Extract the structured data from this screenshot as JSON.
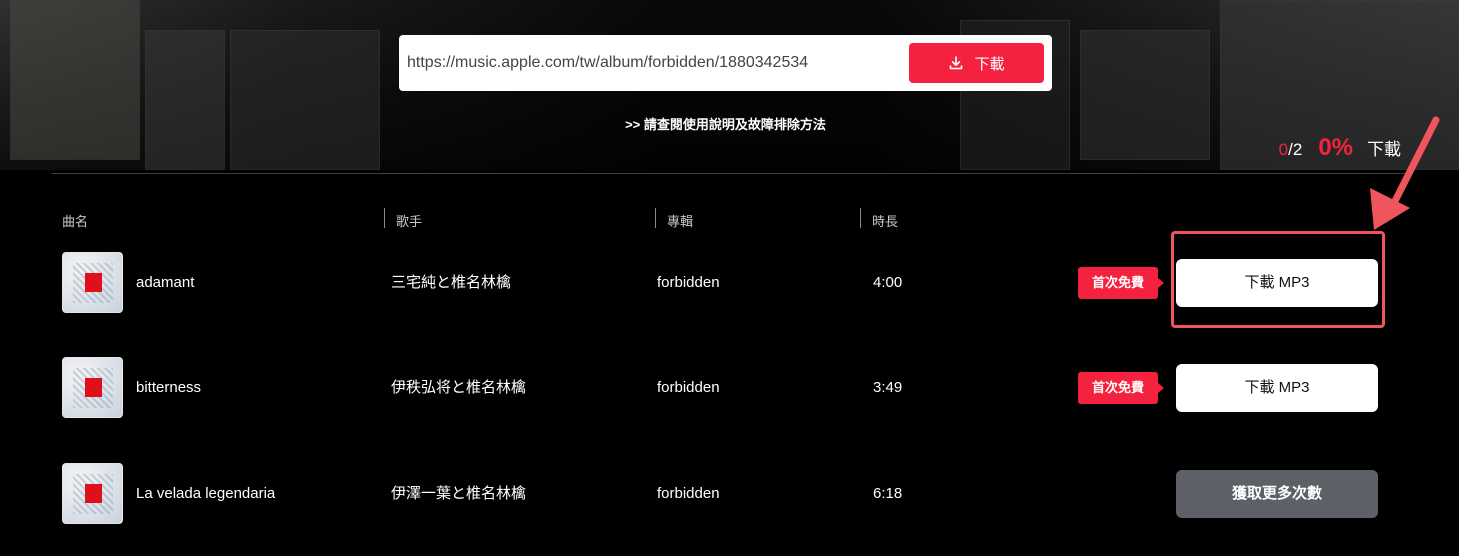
{
  "search": {
    "url_value": "https://music.apple.com/tw/album/forbidden/1880342534",
    "download_label": "下載"
  },
  "help_link": ">> 請查閱使用說明及故障排除方法",
  "progress": {
    "done": "0",
    "total": "/2",
    "percent": "0%",
    "label": "下載"
  },
  "table": {
    "headers": [
      "曲名",
      "歌手",
      "專輯",
      "時長"
    ],
    "rows": [
      {
        "title": "adamant",
        "artist": "三宅純と椎名林檎",
        "album": "forbidden",
        "duration": "4:00",
        "tag": "首次免費",
        "action": "下載 MP3"
      },
      {
        "title": "bitterness",
        "artist": "伊秩弘将と椎名林檎",
        "album": "forbidden",
        "duration": "3:49",
        "tag": "首次免費",
        "action": "下載 MP3"
      },
      {
        "title": "La velada legendaria",
        "artist": "伊澤一葉と椎名林檎",
        "album": "forbidden",
        "duration": "6:18",
        "tag": "",
        "action": "獲取更多次數"
      }
    ]
  },
  "colors": {
    "accent": "#f5223f",
    "highlight": "#f0545d",
    "disabled_button": "#5e6068"
  },
  "icons": {
    "download": "download-icon",
    "arrow": "pointer-arrow"
  }
}
